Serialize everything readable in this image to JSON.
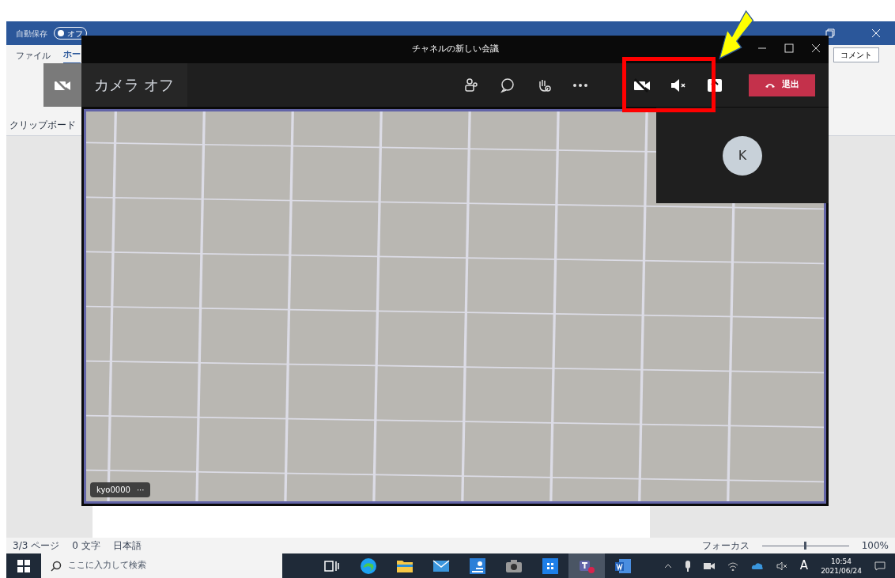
{
  "word": {
    "autosave_label": "自動保存",
    "autosave_state": "オフ",
    "autosave_on": false,
    "tabs": [
      {
        "label": "ファイル",
        "selected": false
      },
      {
        "label": "ホー",
        "selected": true
      }
    ],
    "comment_button": "コメント",
    "clipboard_group": "クリップボード",
    "status_bar": {
      "page": "3/3 ページ",
      "words": "0 文字",
      "language": "日本語",
      "focus": "フォーカス",
      "zoom": "100%",
      "zoom_slider": {
        "level": 0.5
      }
    }
  },
  "teams": {
    "title": "チャネルの新しい会議",
    "camera_label": "カメラ オフ",
    "toolbar": [
      {
        "kind": "participants"
      },
      {
        "kind": "chat"
      },
      {
        "kind": "reactions"
      },
      {
        "kind": "more"
      },
      {
        "kind": "camera",
        "on": false
      },
      {
        "kind": "mic",
        "on": false
      },
      {
        "kind": "share"
      }
    ],
    "leave_button": "退出",
    "participant_initial": "K",
    "name_tag": "kyo0000",
    "name_tag_menu": "···"
  },
  "taskbar": {
    "search_placeholder": "ここに入力して検索",
    "apps": [
      {
        "kind": "taskview",
        "selected": false
      },
      {
        "kind": "edge",
        "selected": false
      },
      {
        "kind": "explorer",
        "selected": false
      },
      {
        "kind": "mail",
        "selected": false
      },
      {
        "kind": "store",
        "selected": false
      },
      {
        "kind": "camera",
        "selected": false
      },
      {
        "kind": "app",
        "selected": false
      },
      {
        "kind": "teams",
        "selected": true
      },
      {
        "kind": "word",
        "selected": false
      }
    ],
    "ime": "A",
    "time": "10:54",
    "date": "2021/06/24"
  }
}
